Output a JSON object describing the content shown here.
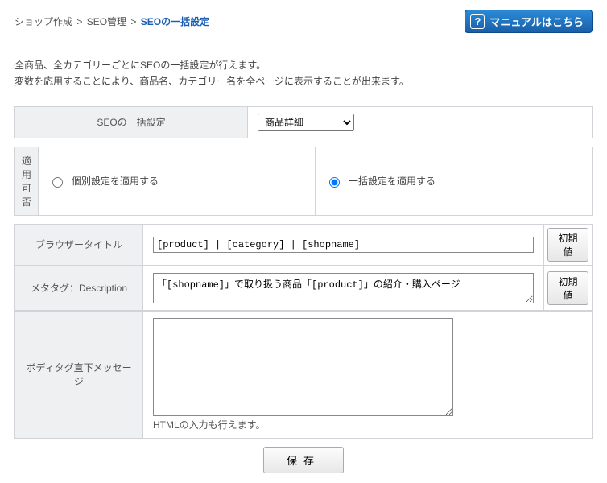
{
  "breadcrumb": {
    "items": [
      "ショップ作成",
      "SEO管理"
    ],
    "current": "SEOの一括設定",
    "sep": ">"
  },
  "manual_button": {
    "label": "マニュアルはこちら",
    "q": "?"
  },
  "intro": {
    "line1": "全商品、全カテゴリーごとにSEOの一括設定が行えます。",
    "line2": "変数を応用することにより、商品名、カテゴリー名を全ページに表示することが出来ます。"
  },
  "section_select": {
    "label": "SEOの一括設定",
    "selected": "商品詳細"
  },
  "apply": {
    "label": "適用可否",
    "option_individual": "個別設定を適用する",
    "option_bulk": "一括設定を適用する",
    "checked": "bulk"
  },
  "fields": {
    "browser_title": {
      "label": "ブラウザータイトル",
      "value": "[product] | [category] | [shopname]",
      "reset": "初期値"
    },
    "meta_desc": {
      "label": "メタタグ：Description",
      "value": "「[shopname]」で取り扱う商品「[product]」の紹介・購入ページ",
      "reset": "初期値"
    },
    "body_msg": {
      "label": "ボディタグ直下メッセージ",
      "value": "",
      "hint": "HTMLの入力も行えます。"
    }
  },
  "save_label": "保存"
}
